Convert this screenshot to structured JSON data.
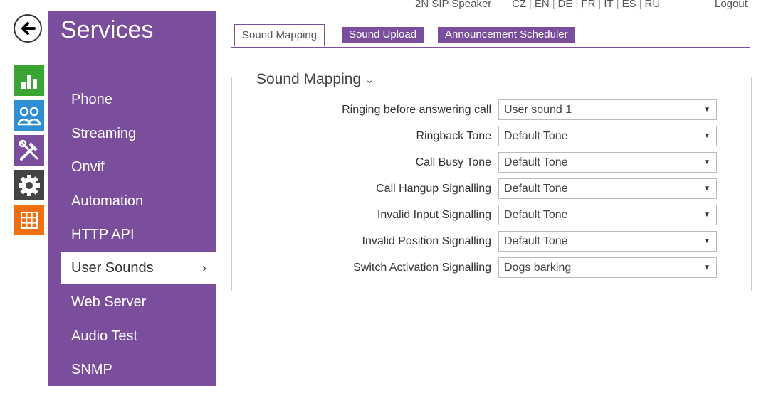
{
  "topbar": {
    "device_name": "2N SIP Speaker",
    "languages": [
      "CZ",
      "EN",
      "DE",
      "FR",
      "IT",
      "ES",
      "RU"
    ],
    "logout_label": "Logout"
  },
  "icons": {
    "back": "back-arrow-icon",
    "status": "bar-chart-icon",
    "users": "users-icon",
    "services": "tools-icon",
    "system": "gear-icon",
    "apps": "grid-icon"
  },
  "colors": {
    "accent": "#7b4e9d",
    "status": "#3aa535",
    "users": "#2f8fd6",
    "system": "#444444",
    "apps": "#f07010"
  },
  "sidebar": {
    "title": "Services",
    "items": [
      {
        "label": "Phone"
      },
      {
        "label": "Streaming"
      },
      {
        "label": "Onvif"
      },
      {
        "label": "Automation"
      },
      {
        "label": "HTTP API"
      },
      {
        "label": "User Sounds",
        "active": true
      },
      {
        "label": "Web Server"
      },
      {
        "label": "Audio Test"
      },
      {
        "label": "SNMP"
      }
    ]
  },
  "tabs": [
    {
      "label": "Sound Mapping",
      "active": true
    },
    {
      "label": "Sound Upload"
    },
    {
      "label": "Announcement Scheduler"
    }
  ],
  "section": {
    "title": "Sound Mapping",
    "rows": [
      {
        "label": "Ringing before answering call",
        "value": "User sound 1"
      },
      {
        "label": "Ringback Tone",
        "value": "Default Tone"
      },
      {
        "label": "Call Busy Tone",
        "value": "Default Tone"
      },
      {
        "label": "Call Hangup Signalling",
        "value": "Default Tone"
      },
      {
        "label": "Invalid Input Signalling",
        "value": "Default Tone"
      },
      {
        "label": "Invalid Position Signalling",
        "value": "Default Tone"
      },
      {
        "label": "Switch Activation Signalling",
        "value": "Dogs barking"
      }
    ]
  }
}
